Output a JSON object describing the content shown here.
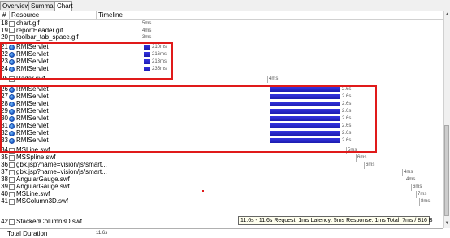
{
  "tabs": [
    {
      "label": "Overview",
      "active": false
    },
    {
      "label": "Summary",
      "active": false
    },
    {
      "label": "Chart",
      "active": true
    }
  ],
  "columns": {
    "num": "#",
    "resource": "Resource",
    "timeline": "Timeline"
  },
  "rows": [
    {
      "num": "18",
      "name": "chart.gif",
      "icon": "document-icon",
      "time": "5ms"
    },
    {
      "num": "19",
      "name": "reportHeader.gif",
      "icon": "document-icon",
      "time": "4ms"
    },
    {
      "num": "20",
      "name": "toolbar_tab_space.gif",
      "icon": "document-icon",
      "time": "3ms"
    },
    {
      "num": "21",
      "name": "RMIServlet",
      "icon": "globe-icon",
      "time": "210ms"
    },
    {
      "num": "22",
      "name": "RMIServlet",
      "icon": "globe-icon",
      "time": "216ms"
    },
    {
      "num": "23",
      "name": "RMIServlet",
      "icon": "globe-icon",
      "time": "213ms"
    },
    {
      "num": "24",
      "name": "RMIServlet",
      "icon": "globe-icon",
      "time": "235ms"
    },
    {
      "num": "25",
      "name": "Radar.swf",
      "icon": "document-icon",
      "time": "4ms"
    },
    {
      "num": "26",
      "name": "RMIServlet",
      "icon": "globe-icon",
      "time": "2.6s"
    },
    {
      "num": "27",
      "name": "RMIServlet",
      "icon": "globe-icon",
      "time": "2.6s"
    },
    {
      "num": "28",
      "name": "RMIServlet",
      "icon": "globe-icon",
      "time": "2.6s"
    },
    {
      "num": "29",
      "name": "RMIServlet",
      "icon": "globe-icon",
      "time": "2.6s"
    },
    {
      "num": "30",
      "name": "RMIServlet",
      "icon": "globe-icon",
      "time": "2.6s"
    },
    {
      "num": "31",
      "name": "RMIServlet",
      "icon": "globe-icon",
      "time": "2.6s"
    },
    {
      "num": "32",
      "name": "RMIServlet",
      "icon": "globe-icon",
      "time": "2.6s"
    },
    {
      "num": "33",
      "name": "RMIServlet",
      "icon": "globe-icon",
      "time": "2.6s"
    },
    {
      "num": "34",
      "name": "MSLine.swf",
      "icon": "document-icon",
      "time": "5ms"
    },
    {
      "num": "35",
      "name": "MSSpline.swf",
      "icon": "document-icon",
      "time": "6ms"
    },
    {
      "num": "36",
      "name": "gbk.jsp?name=vision/js/smart...",
      "icon": "document-icon",
      "time": "6ms"
    },
    {
      "num": "37",
      "name": "gbk.jsp?name=vision/js/smart...",
      "icon": "document-icon",
      "time": "4ms"
    },
    {
      "num": "38",
      "name": "AngularGauge.swf",
      "icon": "document-icon",
      "time": "4ms"
    },
    {
      "num": "39",
      "name": "AngularGauge.swf",
      "icon": "document-icon",
      "time": "6ms"
    },
    {
      "num": "40",
      "name": "MSLine.swf",
      "icon": "document-icon",
      "time": "7ms"
    },
    {
      "num": "41",
      "name": "MSColumn3D.swf",
      "icon": "document-icon",
      "time": "8ms"
    },
    {
      "num": "42",
      "name": "StackedColumn3D.swf",
      "icon": "document-icon",
      "time": ""
    }
  ],
  "footer": {
    "label": "Total Duration",
    "value": "11.6s"
  },
  "tooltip": "11.6s - 11.6s    Request: 1ms Latency: 5ms Response: 1ms Total: 7ms / 816 B",
  "colors": {
    "bar": "#2525c8",
    "highlight": "#e01a1a"
  }
}
